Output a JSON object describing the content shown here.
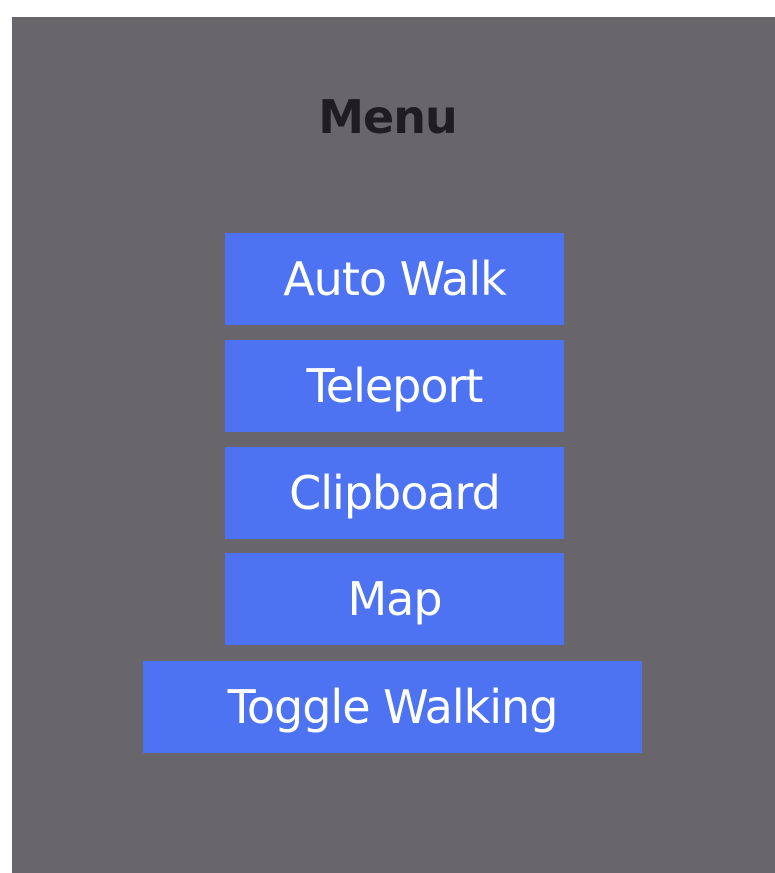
{
  "menu": {
    "title": "Menu",
    "buttons": [
      {
        "label": "Auto Walk"
      },
      {
        "label": "Teleport"
      },
      {
        "label": "Clipboard"
      },
      {
        "label": "Map"
      },
      {
        "label": "Toggle Walking"
      }
    ]
  },
  "colors": {
    "page_background": "#ffffff",
    "panel_background": "#68666b",
    "title_text": "#1f1d21",
    "button_background": "#4d72f2",
    "button_text": "#ffffff"
  }
}
